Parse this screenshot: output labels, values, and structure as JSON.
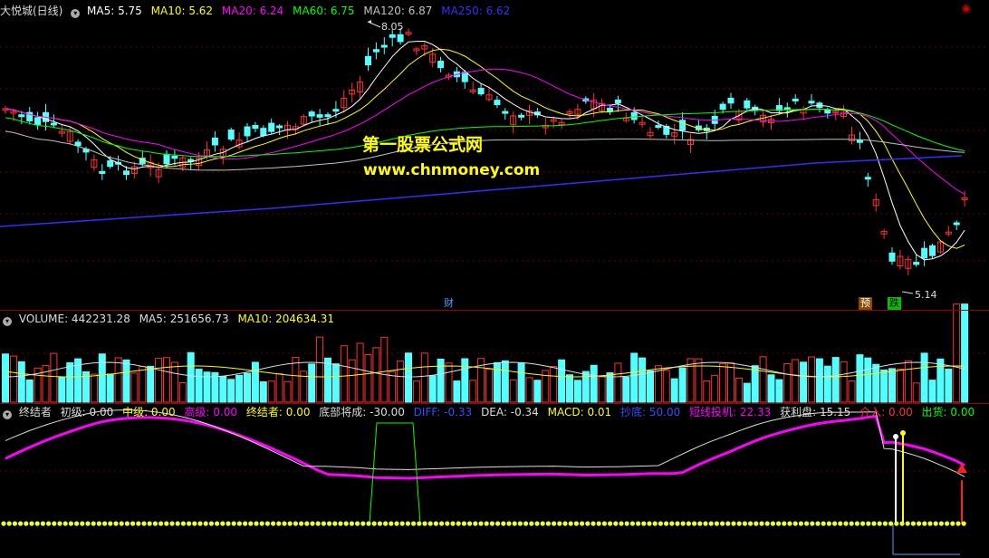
{
  "main_legend": {
    "title": "大悦城(日线)",
    "items": [
      {
        "label": "MA5: 5.75",
        "color": "#ffffff"
      },
      {
        "label": "MA10: 5.62",
        "color": "#ffff00"
      },
      {
        "label": "MA20: 6.24",
        "color": "#ff00ff"
      },
      {
        "label": "MA60: 6.75",
        "color": "#00ff00"
      },
      {
        "label": "MA120: 6.87",
        "color": "#c0c0c0"
      },
      {
        "label": "MA250: 6.62",
        "color": "#3030ff"
      }
    ]
  },
  "price_labels": {
    "high": "8.05",
    "low": "5.14"
  },
  "watermark": {
    "line1": "第一股票公式网",
    "line2": "www.chnmoney.com"
  },
  "tags": {
    "cai": "财",
    "yu": "预",
    "die": "跌"
  },
  "volume_legend": {
    "items": [
      {
        "label": "VOLUME: 442231.28",
        "color": "#dddddd"
      },
      {
        "label": "MA5: 251656.73",
        "color": "#dddddd"
      },
      {
        "label": "MA10: 204634.31",
        "color": "#ffff00"
      }
    ]
  },
  "indicator_legend": {
    "items": [
      {
        "label": "终结者",
        "color": "#dddddd"
      },
      {
        "label": "初级: 0.00",
        "color": "#dddddd"
      },
      {
        "label": "中级: 0.00",
        "color": "#ffff00"
      },
      {
        "label": "高级: 0.00",
        "color": "#ff00ff"
      },
      {
        "label": "终结者: 0.00",
        "color": "#ffff00"
      },
      {
        "label": "底部将成: -30.00",
        "color": "#dddddd"
      },
      {
        "label": "DIFF: -0.33",
        "color": "#3050ff"
      },
      {
        "label": "DEA: -0.34",
        "color": "#dddddd"
      },
      {
        "label": "MACD: 0.01",
        "color": "#ffff00"
      },
      {
        "label": "抄底: 50.00",
        "color": "#3050ff"
      },
      {
        "label": "短线投机: 22.33",
        "color": "#ff00ff"
      },
      {
        "label": "获利盘: 15.15",
        "color": "#dddddd"
      },
      {
        "label": "介入: 0.00",
        "color": "#ff3030"
      },
      {
        "label": "出货: 0.00",
        "color": "#00ff00"
      }
    ]
  },
  "colors": {
    "up": "#ff3232",
    "down": "#54ffff",
    "grid": "#9a0000"
  }
}
